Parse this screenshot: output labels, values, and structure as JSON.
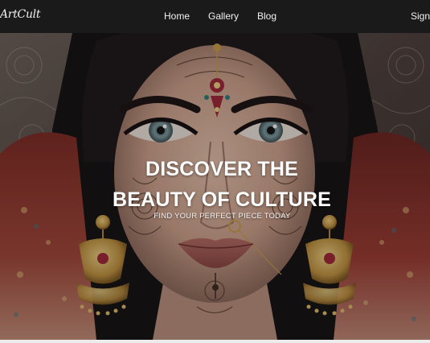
{
  "navbar": {
    "logo_text": "ArtCult",
    "links": [
      "Home",
      "Gallery",
      "Blog"
    ],
    "sign_label": "Sign"
  },
  "hero": {
    "title_line1": "DISCOVER THE",
    "title_line2": "BEAUTY OF CULTURE",
    "subtitle": "FIND YOUR PERFECT PIECE TODAY",
    "image_subject": "illustrated portrait of a woman wearing traditional henna patterns, bindi and gold jhumka earrings"
  },
  "colors": {
    "navbar_bg": "#1a1a1a",
    "nav_text": "#f2f2f2",
    "hero_text": "#ffffff",
    "gold": "#c9a04a",
    "henna": "#4a3226"
  }
}
